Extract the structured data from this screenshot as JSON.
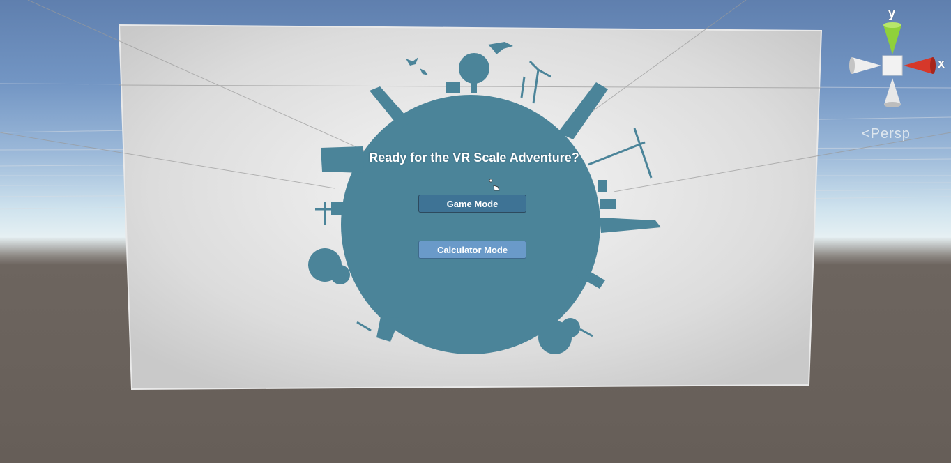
{
  "menu": {
    "title": "Ready for the VR Scale Adventure?",
    "buttons": {
      "game_mode": "Game Mode",
      "calculator_mode": "Calculator Mode"
    }
  },
  "scene_gizmo": {
    "y_label": "y",
    "x_label": "x",
    "projection_label": "Persp"
  },
  "colors": {
    "planet": "#4b8499",
    "game_button": "#3e7395",
    "calculator_button": "#6a9ac9",
    "gizmo_y_axis": "#8fd13a",
    "gizmo_x_axis": "#d6382a"
  }
}
